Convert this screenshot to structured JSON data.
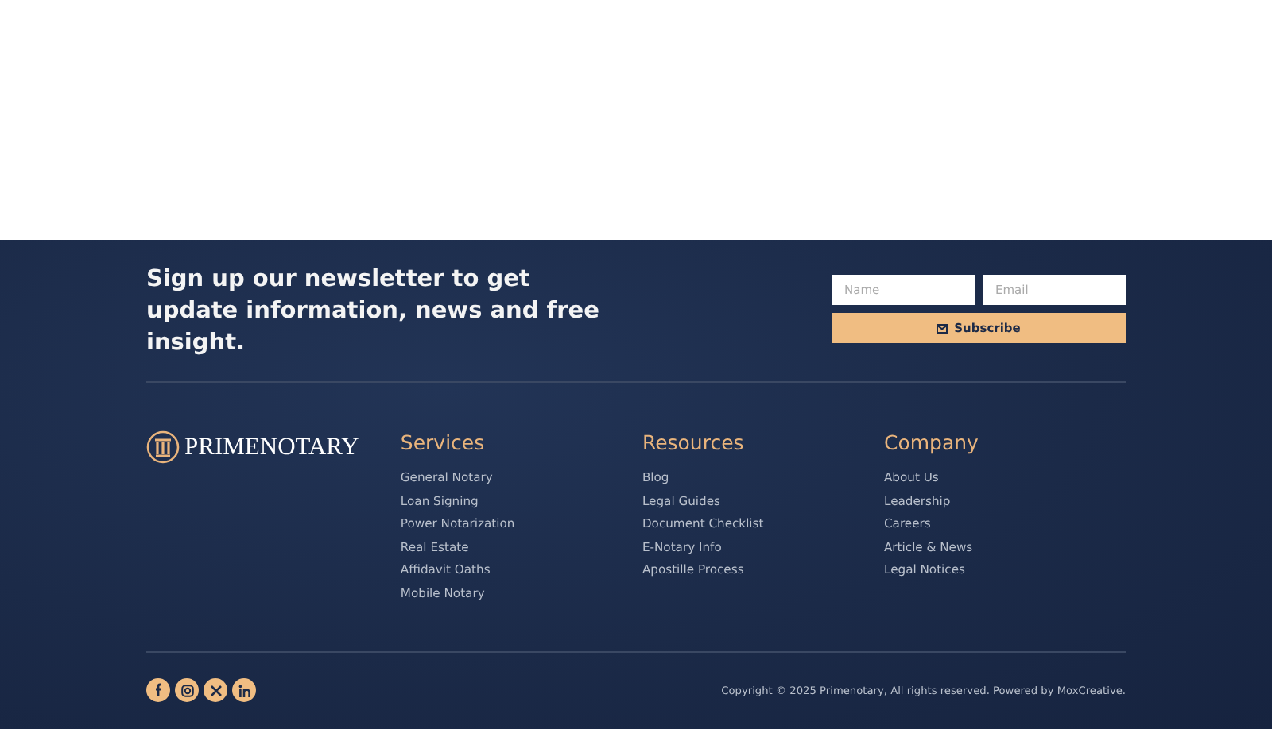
{
  "newsletter": {
    "heading": "Sign up our newsletter to get update information, news and free insight.",
    "name_field": {
      "placeholder": "Name"
    },
    "email_field": {
      "placeholder": "Email"
    },
    "button": "Subscribe"
  },
  "logo": {
    "text": "PRIMENOTARY"
  },
  "columns": [
    {
      "title": "Services",
      "links": [
        "General Notary",
        "Loan Signing",
        "Power Notarization",
        "Real Estate",
        "Affidavit Oaths",
        "Mobile Notary"
      ]
    },
    {
      "title": "Resources",
      "links": [
        "Blog",
        "Legal Guides",
        "Document Checklist",
        "E-Notary Info",
        "Apostille Process"
      ]
    },
    {
      "title": "Company",
      "links": [
        "About Us",
        "Leadership",
        "Careers",
        "Article & News",
        "Legal Notices"
      ]
    }
  ],
  "social": [
    {
      "kind": "facebook"
    },
    {
      "kind": "instagram"
    },
    {
      "kind": "x"
    },
    {
      "kind": "linkedin"
    }
  ],
  "copyright": "Copyright © 2025 Primenotary, All rights reserved. Powered by MoxCreative."
}
